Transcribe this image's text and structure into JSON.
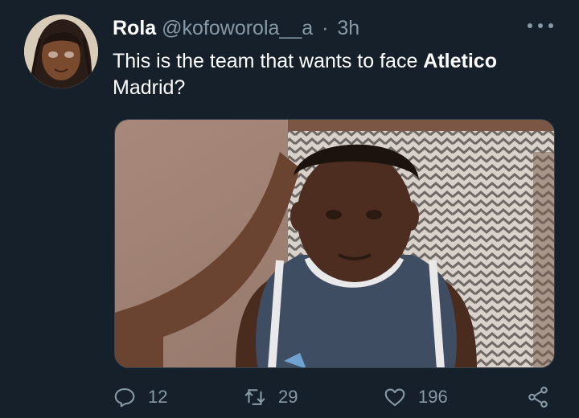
{
  "tweet": {
    "author_name": "Rola",
    "author_handle": "@kofoworola__a",
    "separator": "·",
    "time": "3h",
    "text_before": "This is the team that wants to face ",
    "text_bold": "Atletico",
    "text_after": " Madrid?"
  },
  "actions": {
    "reply_count": "12",
    "retweet_count": "29",
    "like_count": "196"
  },
  "icons": {
    "more": "more-horizontal-icon",
    "reply": "reply-icon",
    "retweet": "retweet-icon",
    "like": "heart-icon",
    "share": "share-icon"
  },
  "colors": {
    "background": "#15202b",
    "secondary_text": "#8899a6",
    "primary_text": "#ffffff"
  }
}
